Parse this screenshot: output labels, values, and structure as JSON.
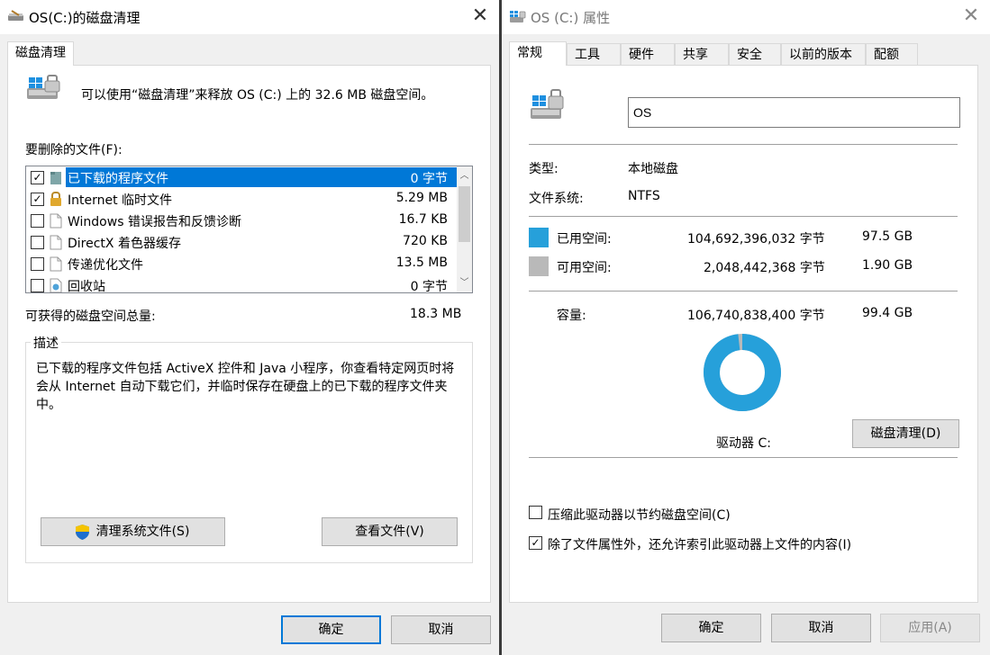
{
  "left_window": {
    "title": "OS(C:)的磁盘清理",
    "tab": "磁盘清理",
    "intro": "可以使用“磁盘清理”来释放 OS (C:) 上的 32.6 MB 磁盘空间。",
    "files_label": "要删除的文件(F):",
    "files": [
      {
        "name": "已下载的程序文件",
        "size": "0 字节",
        "checked": true,
        "selected": true,
        "icon": "folder-icon"
      },
      {
        "name": "Internet 临时文件",
        "size": "5.29 MB",
        "checked": true,
        "selected": false,
        "icon": "lock-icon"
      },
      {
        "name": "Windows 错误报告和反馈诊断",
        "size": "16.7 KB",
        "checked": false,
        "selected": false,
        "icon": "file-icon"
      },
      {
        "name": "DirectX 着色器缓存",
        "size": "720 KB",
        "checked": false,
        "selected": false,
        "icon": "file-icon"
      },
      {
        "name": "传递优化文件",
        "size": "13.5 MB",
        "checked": false,
        "selected": false,
        "icon": "file-icon"
      },
      {
        "name": "回收站",
        "size": "0 字节",
        "checked": false,
        "selected": false,
        "icon": "recycle-bin-icon"
      }
    ],
    "total_label": "可获得的磁盘空间总量:",
    "total_value": "18.3 MB",
    "description_legend": "描述",
    "description_text": "已下载的程序文件包括 ActiveX 控件和 Java 小程序，你查看特定网页时将会从 Internet 自动下载它们，并临时保存在硬盘上的已下载的程序文件夹中。",
    "clean_system_button": "清理系统文件(S)",
    "view_files_button": "查看文件(V)",
    "ok_button": "确定",
    "cancel_button": "取消"
  },
  "right_window": {
    "title": "OS (C:) 属性",
    "tabs": [
      "常规",
      "工具",
      "硬件",
      "共享",
      "安全",
      "以前的版本",
      "配额"
    ],
    "active_tab": "常规",
    "drive_name": "OS",
    "type_label": "类型:",
    "type_value": "本地磁盘",
    "fs_label": "文件系统:",
    "fs_value": "NTFS",
    "used_label": "已用空间:",
    "used_bytes": "104,692,396,032 字节",
    "used_gb": "97.5 GB",
    "free_label": "可用空间:",
    "free_bytes": "2,048,442,368 字节",
    "free_gb": "1.90 GB",
    "capacity_label": "容量:",
    "capacity_bytes": "106,740,838,400 字节",
    "capacity_gb": "99.4 GB",
    "used_fraction": 0.981,
    "drive_label": "驱动器 C:",
    "disk_cleanup_button": "磁盘清理(D)",
    "compress_label": "压缩此驱动器以节约磁盘空间(C)",
    "compress_checked": false,
    "index_label": "除了文件属性外，还允许索引此驱动器上文件的内容(I)",
    "index_checked": true,
    "ok_button": "确定",
    "cancel_button": "取消",
    "apply_button": "应用(A)"
  },
  "colors": {
    "used": "#26a0da",
    "free": "#b9b9b9",
    "selection": "#0078d7"
  }
}
